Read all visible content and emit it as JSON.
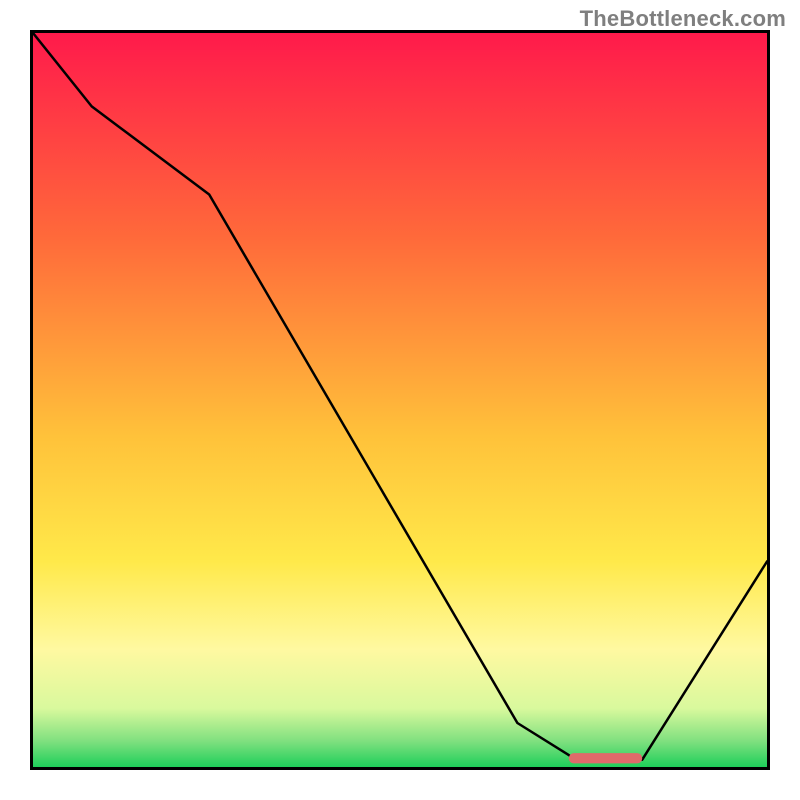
{
  "watermark": "TheBottleneck.com",
  "chart_data": {
    "type": "line",
    "title": "",
    "xlabel": "",
    "ylabel": "",
    "xlim": [
      0,
      100
    ],
    "ylim": [
      0,
      100
    ],
    "grid": false,
    "legend": false,
    "background_gradient_stops": [
      {
        "offset": 0,
        "color": "#ff1a4b"
      },
      {
        "offset": 0.28,
        "color": "#ff6a3a"
      },
      {
        "offset": 0.55,
        "color": "#ffc23a"
      },
      {
        "offset": 0.72,
        "color": "#ffe94a"
      },
      {
        "offset": 0.84,
        "color": "#fff9a1"
      },
      {
        "offset": 0.92,
        "color": "#d9f99d"
      },
      {
        "offset": 0.965,
        "color": "#7fe07f"
      },
      {
        "offset": 1.0,
        "color": "#1ecf5a"
      }
    ],
    "series": [
      {
        "name": "bottleneck-curve",
        "color": "#000000",
        "x": [
          0,
          8,
          24,
          66,
          74,
          83,
          100
        ],
        "y": [
          100,
          90,
          78,
          6,
          1,
          1,
          28
        ]
      }
    ],
    "marker": {
      "name": "selection-marker",
      "color": "#e06a6a",
      "x_start": 73,
      "x_end": 83,
      "y": 1.2,
      "thickness_pct": 1.4
    }
  }
}
